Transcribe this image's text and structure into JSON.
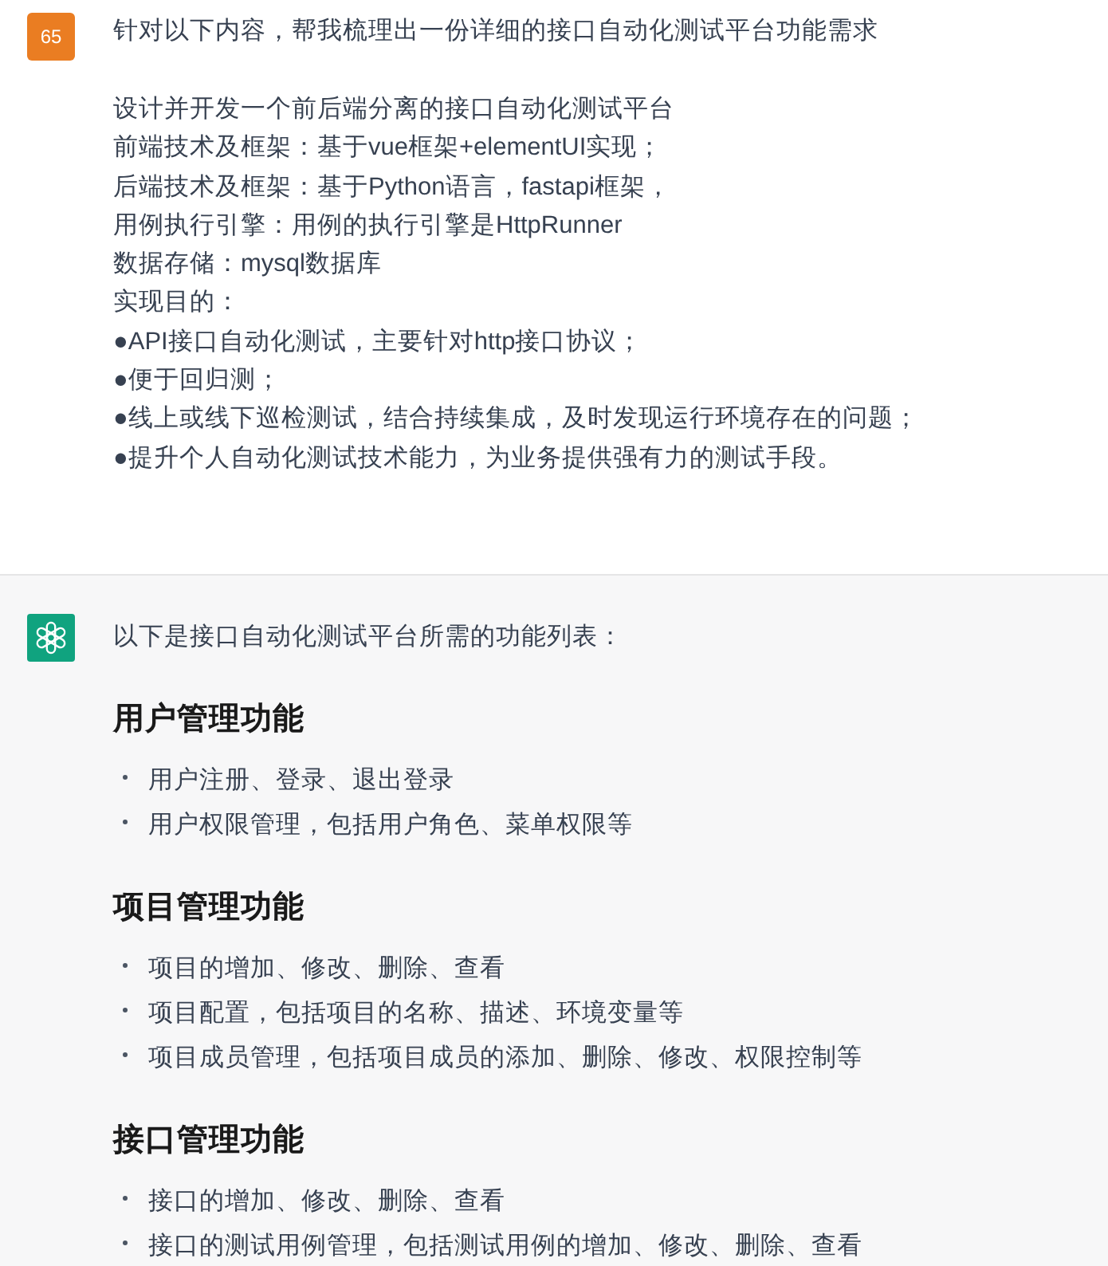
{
  "user_message": {
    "avatar": "65",
    "title": "针对以下内容，帮我梳理出一份详细的接口自动化测试平台功能需求",
    "lines": [
      "设计并开发一个前后端分离的接口自动化测试平台",
      "前端技术及框架：基于vue框架+elementUI实现；",
      "后端技术及框架：基于Python语言，fastapi框架，",
      "用例执行引擎：用例的执行引擎是HttpRunner",
      "数据存储：mysql数据库",
      "实现目的：",
      "●API接口自动化测试，主要针对http接口协议；",
      "●便于回归测；",
      "●线上或线下巡检测试，结合持续集成，及时发现运行环境存在的问题；",
      "●提升个人自动化测试技术能力，为业务提供强有力的测试手段。"
    ]
  },
  "assistant_message": {
    "intro": "以下是接口自动化测试平台所需的功能列表：",
    "sections": [
      {
        "heading": "用户管理功能",
        "items": [
          "用户注册、登录、退出登录",
          "用户权限管理，包括用户角色、菜单权限等"
        ]
      },
      {
        "heading": "项目管理功能",
        "items": [
          "项目的增加、修改、删除、查看",
          "项目配置，包括项目的名称、描述、环境变量等",
          "项目成员管理，包括项目成员的添加、删除、修改、权限控制等"
        ]
      },
      {
        "heading": "接口管理功能",
        "items": [
          "接口的增加、修改、删除、查看",
          "接口的测试用例管理，包括测试用例的增加、修改、删除、查看"
        ]
      }
    ]
  }
}
